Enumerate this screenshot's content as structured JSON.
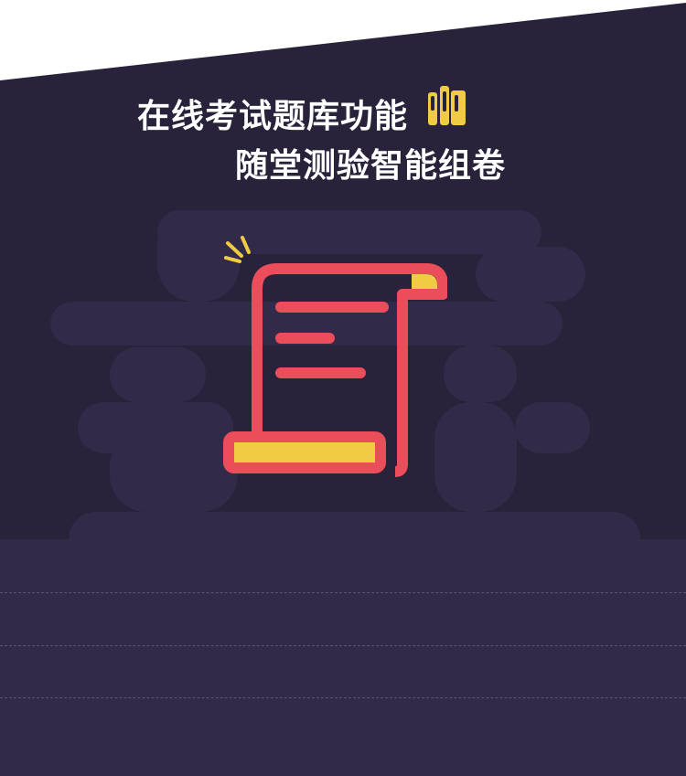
{
  "headline": {
    "line1": "在线考试题库功能",
    "line2": "随堂测验智能组卷"
  },
  "icons": {
    "books": "books-icon",
    "scroll": "exam-paper-scroll-icon"
  },
  "colors": {
    "background": "#28223a",
    "cloud": "#312a48",
    "accent_red": "#ec4d5b",
    "accent_yellow": "#f2cb45",
    "text": "#ffffff"
  }
}
